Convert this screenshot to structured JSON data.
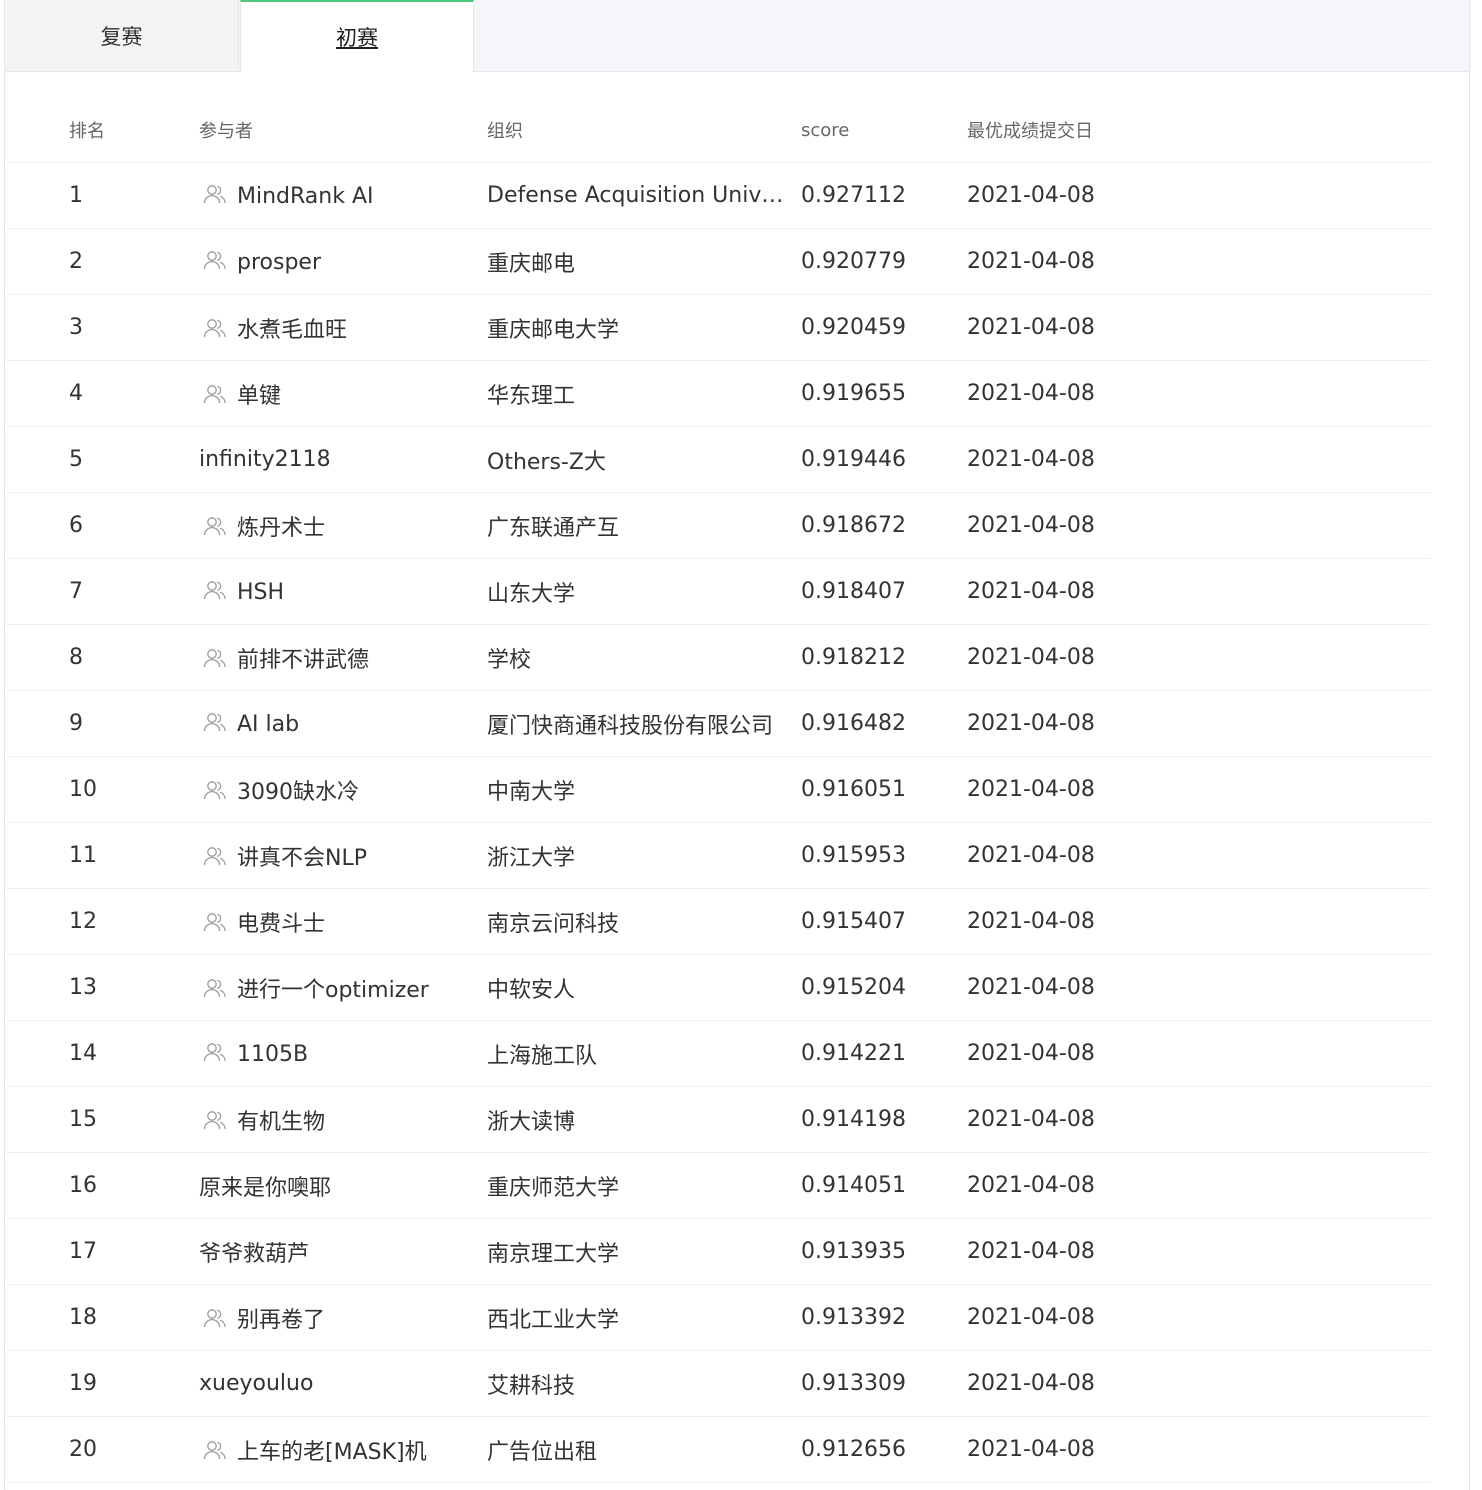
{
  "tabs": [
    {
      "label": "复赛",
      "active": false
    },
    {
      "label": "初赛",
      "active": true
    }
  ],
  "table": {
    "headers": {
      "rank": "排名",
      "participant": "参与者",
      "organization": "组织",
      "score": "score",
      "date": "最优成绩提交日"
    },
    "rows": [
      {
        "rank": "1",
        "team": true,
        "name": "MindRank AI",
        "org": "Defense Acquisition University",
        "score": "0.927112",
        "date": "2021-04-08"
      },
      {
        "rank": "2",
        "team": true,
        "name": "prosper",
        "org": "重庆邮电",
        "score": "0.920779",
        "date": "2021-04-08"
      },
      {
        "rank": "3",
        "team": true,
        "name": "水煮毛血旺",
        "org": "重庆邮电大学",
        "score": "0.920459",
        "date": "2021-04-08"
      },
      {
        "rank": "4",
        "team": true,
        "name": "单键",
        "org": "华东理工",
        "score": "0.919655",
        "date": "2021-04-08"
      },
      {
        "rank": "5",
        "team": false,
        "name": "infinity2118",
        "org": "Others-Z大",
        "score": "0.919446",
        "date": "2021-04-08"
      },
      {
        "rank": "6",
        "team": true,
        "name": "炼丹术士",
        "org": "广东联通产互",
        "score": "0.918672",
        "date": "2021-04-08"
      },
      {
        "rank": "7",
        "team": true,
        "name": "HSH",
        "org": "山东大学",
        "score": "0.918407",
        "date": "2021-04-08"
      },
      {
        "rank": "8",
        "team": true,
        "name": "前排不讲武德",
        "org": "学校",
        "score": "0.918212",
        "date": "2021-04-08"
      },
      {
        "rank": "9",
        "team": true,
        "name": "AI lab",
        "org": "厦门快商通科技股份有限公司",
        "score": "0.916482",
        "date": "2021-04-08"
      },
      {
        "rank": "10",
        "team": true,
        "name": "3090缺水冷",
        "org": "中南大学",
        "score": "0.916051",
        "date": "2021-04-08"
      },
      {
        "rank": "11",
        "team": true,
        "name": "讲真不会NLP",
        "org": "浙江大学",
        "score": "0.915953",
        "date": "2021-04-08"
      },
      {
        "rank": "12",
        "team": true,
        "name": "电费斗士",
        "org": "南京云问科技",
        "score": "0.915407",
        "date": "2021-04-08"
      },
      {
        "rank": "13",
        "team": true,
        "name": "进行一个optimizer",
        "org": "中软安人",
        "score": "0.915204",
        "date": "2021-04-08"
      },
      {
        "rank": "14",
        "team": true,
        "name": "1105B",
        "org": "上海施工队",
        "score": "0.914221",
        "date": "2021-04-08"
      },
      {
        "rank": "15",
        "team": true,
        "name": "有机生物",
        "org": "浙大读博",
        "score": "0.914198",
        "date": "2021-04-08"
      },
      {
        "rank": "16",
        "team": false,
        "name": "原来是你噢耶",
        "org": "重庆师范大学",
        "score": "0.914051",
        "date": "2021-04-08"
      },
      {
        "rank": "17",
        "team": false,
        "name": "爷爷救葫芦",
        "org": "南京理工大学",
        "score": "0.913935",
        "date": "2021-04-08"
      },
      {
        "rank": "18",
        "team": true,
        "name": "别再卷了",
        "org": "西北工业大学",
        "score": "0.913392",
        "date": "2021-04-08"
      },
      {
        "rank": "19",
        "team": false,
        "name": "xueyouluo",
        "org": "艾耕科技",
        "score": "0.913309",
        "date": "2021-04-08"
      },
      {
        "rank": "20",
        "team": true,
        "name": "上车的老[MASK]机",
        "org": "广告位出租",
        "score": "0.912656",
        "date": "2021-04-08"
      }
    ]
  },
  "icons": {
    "team": "team-users-icon"
  },
  "colors": {
    "rank": "#f0b86c",
    "active_tab_accent": "#4cc97a"
  }
}
